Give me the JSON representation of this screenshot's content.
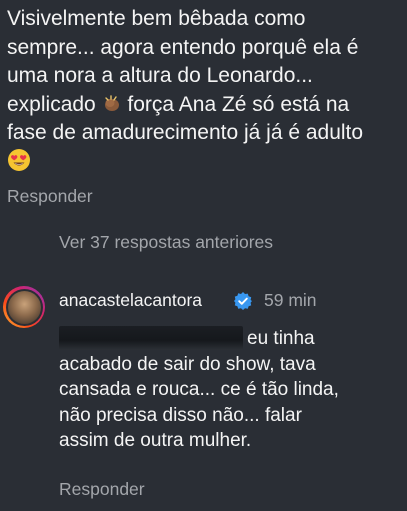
{
  "main_comment": {
    "line1": "Visivelmente bem bêbada como",
    "line2": "sempre... agora entendo porquê ela é",
    "line3": "uma nora a altura do Leonardo...",
    "line4_before_emoji": "explicado ",
    "line4_after_emoji": " força Ana Zé só está na",
    "line5": "fase de amadurecimento já já é adulto",
    "emoji_1": "clapping-hands-emoji",
    "emoji_2": "heart-eyes-emoji",
    "reply_label": "Responder"
  },
  "view_replies": "Ver 37 respostas anteriores",
  "reply": {
    "username": "anacastelacantora",
    "timestamp": "59 min",
    "text_after_redaction": "eu tinha",
    "line2": "acabado de sair do show, tava",
    "line3": "cansada e rouca... ce é tão linda,",
    "line4": "não precisa disso não... falar",
    "line5": "assim de outra mulher.",
    "reply_label": "Responder",
    "verified_icon": "verified-badge-icon"
  },
  "colors": {
    "background": "#2a2e35",
    "text": "#f4f4f4",
    "muted": "#a3a6ab",
    "verified": "#3897f0"
  }
}
